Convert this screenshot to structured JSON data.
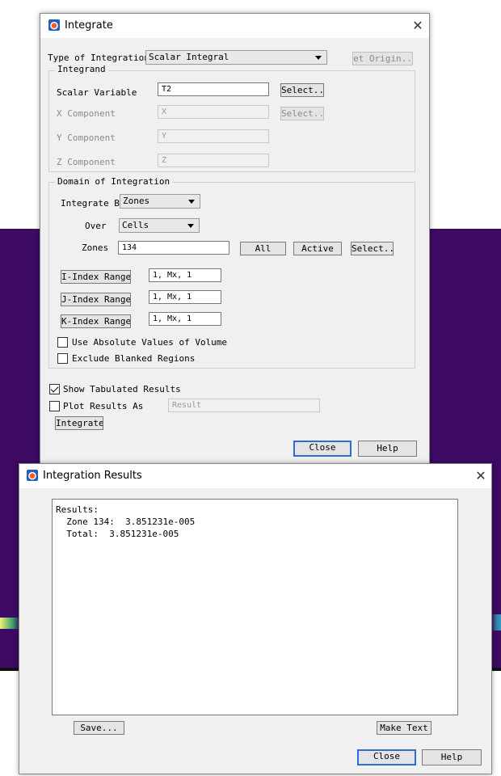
{
  "integrate_dialog": {
    "title": "Integrate",
    "type_label": "Type of Integration",
    "type_value": "Scalar Integral",
    "set_origin_label": "et Origin..",
    "integrand": {
      "title": "Integrand",
      "scalar_variable_label": "Scalar Variable",
      "scalar_variable_value": "T2",
      "select_label": "Select...",
      "x_label": "X Component",
      "x_value": "X",
      "x_select_label": "Select...",
      "y_label": "Y Component",
      "y_value": "Y",
      "z_label": "Z Component",
      "z_value": "Z"
    },
    "domain": {
      "title": "Domain of Integration",
      "integrate_by_label": "Integrate By",
      "integrate_by_value": "Zones",
      "over_label": "Over",
      "over_value": "Cells",
      "zones_label": "Zones",
      "zones_value": "134",
      "all_label": "All",
      "active_label": "Active",
      "select_label": "Select...",
      "i_range_label": "I-Index Range",
      "i_range_value": "1, Mx, 1",
      "j_range_label": "J-Index Range",
      "j_range_value": "1, Mx, 1",
      "k_range_label": "K-Index Range",
      "k_range_value": "1, Mx, 1",
      "abs_values_label": "Use Absolute Values of Volume",
      "abs_values_checked": false,
      "exclude_blanked_label": "Exclude Blanked Regions",
      "exclude_blanked_checked": false
    },
    "show_tabulated_label": "Show Tabulated Results",
    "show_tabulated_checked": true,
    "plot_results_label": "Plot Results As",
    "plot_results_checked": false,
    "plot_results_value": "Result",
    "integrate_button": "Integrate",
    "close_button": "Close",
    "help_button": "Help"
  },
  "results_dialog": {
    "title": "Integration Results",
    "results_lines": [
      "Results:",
      "  Zone 134:  3.851231e-005",
      "  Total:  3.851231e-005"
    ],
    "save_button": "Save...",
    "make_text_button": "Make Text",
    "close_button": "Close",
    "help_button": "Help"
  },
  "colors": {
    "background_plot": "#3e0b63",
    "dialog_face": "#f0f0f0",
    "default_button_border": "#2a6fd1"
  }
}
